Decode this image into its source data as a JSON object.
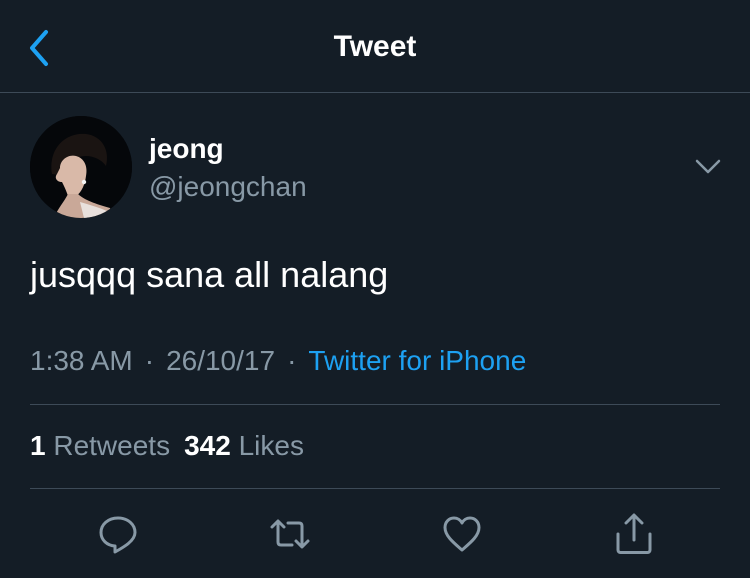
{
  "header": {
    "title": "Tweet",
    "back_icon": "chevron-left-icon"
  },
  "author": {
    "name": "jeong",
    "handle": "@jeongchan"
  },
  "tweet": {
    "text": "jusqqq sana all nalang",
    "time": "1:38 AM",
    "separator": "·",
    "date": "26/10/17",
    "source": "Twitter for iPhone"
  },
  "stats": {
    "retweets_count": "1",
    "retweets_label": "Retweets",
    "likes_count": "342",
    "likes_label": "Likes"
  },
  "actions": {
    "reply_icon": "reply-icon",
    "retweet_icon": "retweet-icon",
    "like_icon": "heart-icon",
    "share_icon": "share-icon"
  },
  "colors": {
    "background": "#141d26",
    "accent": "#1da1f2",
    "secondary_text": "#8899a6",
    "divider": "#3d4a57"
  }
}
